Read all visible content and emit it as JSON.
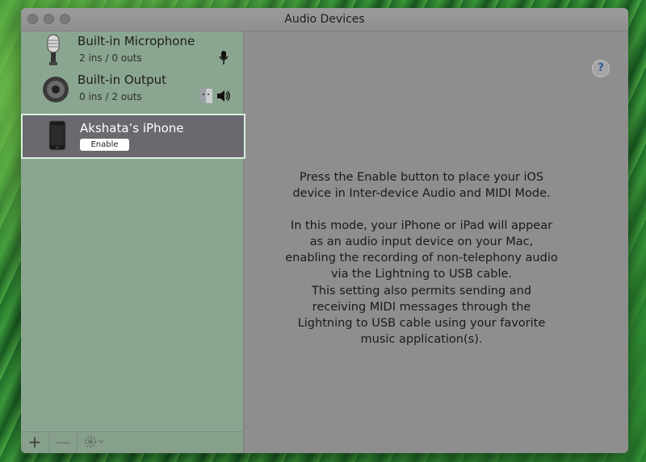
{
  "window": {
    "title": "Audio Devices"
  },
  "devices": [
    {
      "name": "Built-in Microphone",
      "io": "2 ins / 0 outs",
      "icon": "microphone-icon"
    },
    {
      "name": "Built-in Output",
      "io": "0 ins / 2 outs",
      "icon": "speaker-icon"
    },
    {
      "name": "Akshata’s iPhone",
      "button": "Enable",
      "icon": "iphone-icon",
      "selected": true
    }
  ],
  "toolbar": {
    "add": "+",
    "remove": "—"
  },
  "main": {
    "help": "?",
    "paragraph1": "Press the Enable button to place your iOS device in Inter-device Audio and MIDI Mode.",
    "paragraph2": "In this mode, your iPhone or iPad will appear as an audio input device on your Mac, enabling the recording of non-telephony audio via the Lightning to USB cable.",
    "paragraph3": "This setting also permits sending and receiving MIDI messages through the Lightning to USB cable using your favorite music application(s)."
  }
}
